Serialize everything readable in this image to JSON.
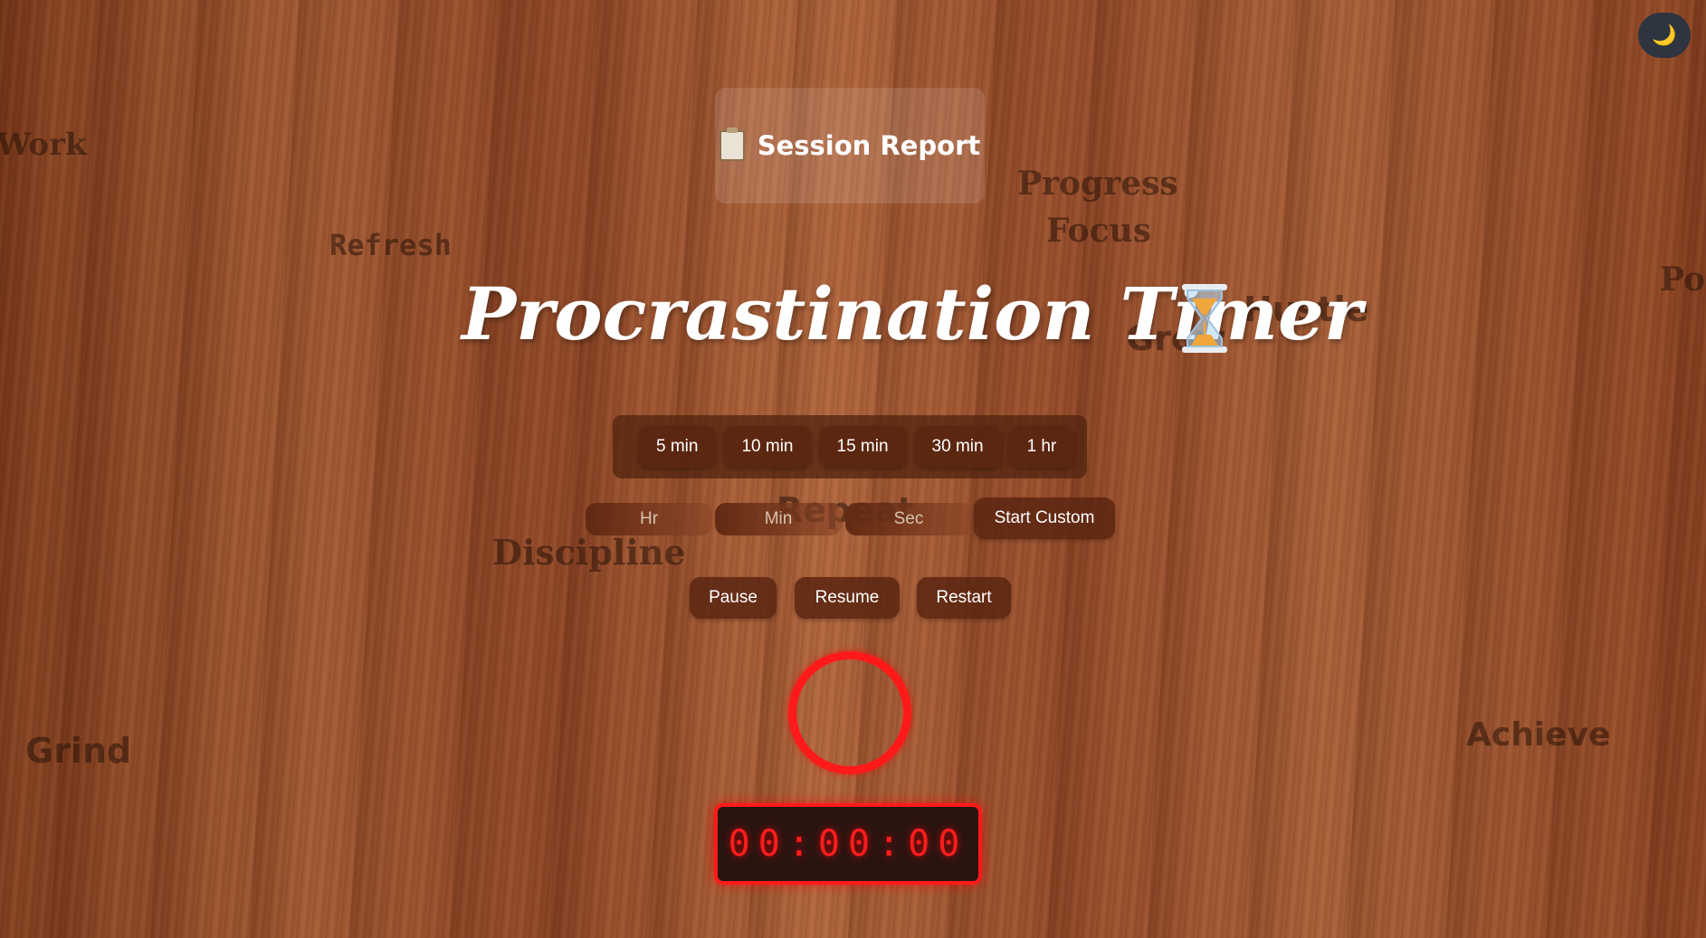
{
  "theme_toggle": {
    "icon": "moon-icon",
    "glyph": "🌙"
  },
  "session_report": {
    "label": "Session Report",
    "icon": "clipboard-icon"
  },
  "title": "Procrastination Timer",
  "title_icon": "hourglass-icon",
  "presets": [
    "5 min",
    "10 min",
    "15 min",
    "30 min",
    "1 hr"
  ],
  "custom": {
    "hr_placeholder": "Hr",
    "min_placeholder": "Min",
    "sec_placeholder": "Sec",
    "start_label": "Start Custom"
  },
  "controls": {
    "pause": "Pause",
    "resume": "Resume",
    "restart": "Restart"
  },
  "timer": {
    "display": "00:00:00",
    "progress": 1.0
  },
  "background_words": {
    "work": "Work",
    "refresh": "Refresh",
    "progress": "Progress",
    "focus": "Focus",
    "po": "Po",
    "hustle": "Hustle",
    "grow": "Grow",
    "repeat": "Repeat",
    "discipline": "Discipline",
    "grind": "Grind",
    "achieve": "Achieve"
  },
  "colors": {
    "accent": "#ff1a1a",
    "button": "#5a2610",
    "wood": "#a25a35"
  }
}
